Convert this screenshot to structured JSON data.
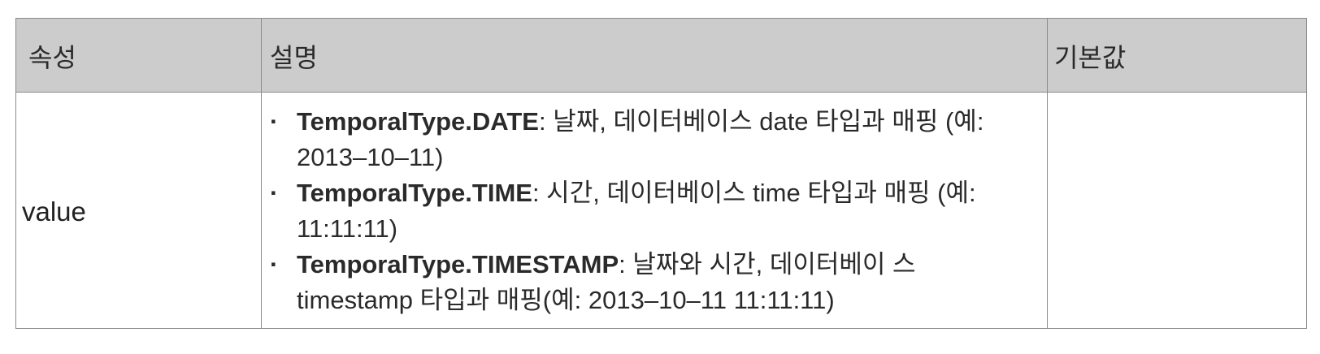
{
  "table": {
    "headers": {
      "attribute": "속성",
      "description": "설명",
      "default": "기본값"
    },
    "rows": [
      {
        "attribute": "value",
        "items": [
          {
            "term": "TemporalType.DATE",
            "text": ": 날짜, 데이터베이스 date 타입과 매핑 (예: 2013–10–11)"
          },
          {
            "term": "TemporalType.TIME",
            "text": ": 시간, 데이터베이스 time 타입과 매핑 (예: 11:11:11)"
          },
          {
            "term": "TemporalType.TIMESTAMP",
            "text": ": 날짜와 시간, 데이터베이 스 timestamp 타입과 매핑(예: 2013–10–11 11:11:11)"
          }
        ],
        "default": ""
      }
    ],
    "bullet_char": "·"
  }
}
